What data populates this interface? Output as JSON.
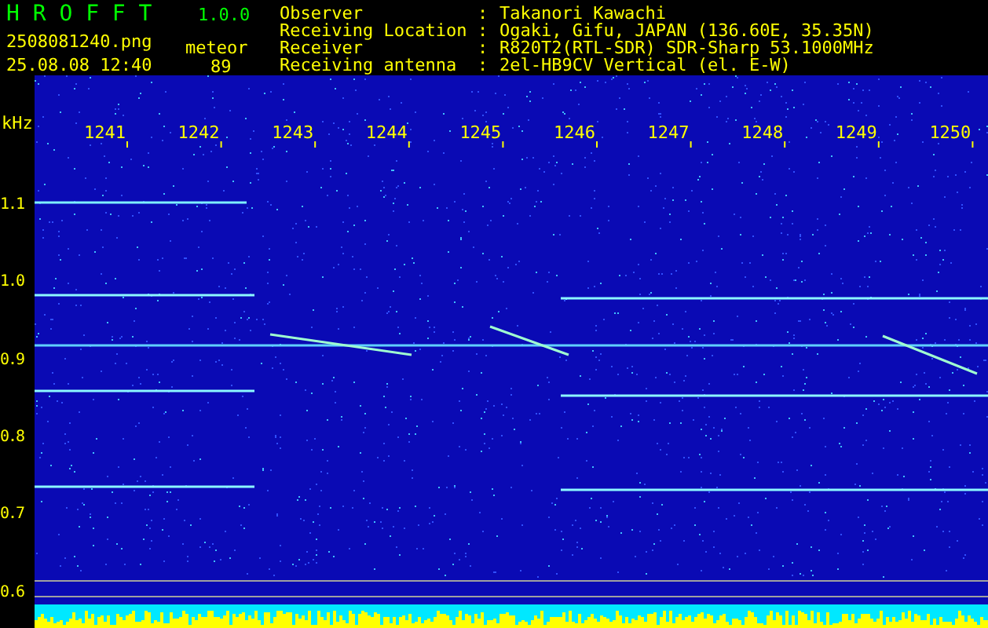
{
  "header": {
    "app_name": "H R O F F T",
    "version": "1.0.0",
    "filename": "2508081240.png",
    "timestamp": "25.08.08 12:40",
    "detection_label": "meteor",
    "detection_count": "89",
    "info": [
      {
        "label": "Observer",
        "separator": ":",
        "value": "Takanori Kawachi"
      },
      {
        "label": "Receiving Location",
        "separator": ":",
        "value": "Ogaki, Gifu, JAPAN (136.60E, 35.35N)"
      },
      {
        "label": "Receiver",
        "separator": ":",
        "value": "R820T2(RTL-SDR) SDR-Sharp 53.1000MHz"
      },
      {
        "label": "Receiving antenna",
        "separator": ":",
        "value": "2el-HB9CV Vertical (el. E-W)"
      }
    ]
  },
  "spectrogram": {
    "y_unit": "kHz",
    "x_labels": [
      "1241",
      "1242",
      "1243",
      "1244",
      "1245",
      "1246",
      "1247",
      "1248",
      "1249",
      "1250"
    ],
    "y_labels": [
      "1.1",
      "1.0",
      "0.9",
      "0.8",
      "0.7",
      "0.6"
    ]
  }
}
